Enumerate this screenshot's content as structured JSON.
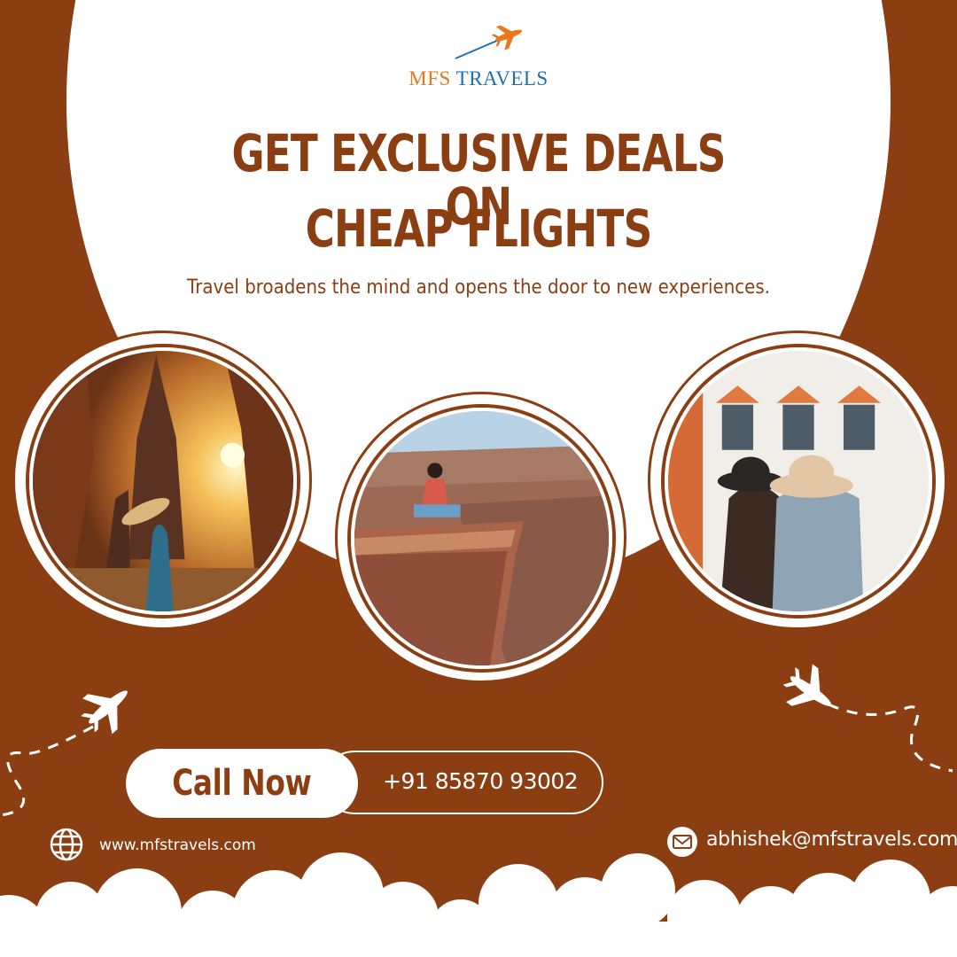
{
  "brand": {
    "part1": "MFS",
    "part2": "TRAVELS",
    "colors": {
      "mfs": "#e8771e",
      "travels": "#1f6fb2"
    }
  },
  "headline": {
    "line1": "GET EXCLUSIVE DEALS ON",
    "line2": "CHEAP FLIGHTS"
  },
  "tagline": "Travel broadens the mind and opens the door to new experiences.",
  "cta": {
    "button_label": "Call Now",
    "phone": "+91 85870 93002"
  },
  "contact": {
    "website": "www.mfstravels.com",
    "email": "abhishek@mfstravels.com",
    "website_icon": "globe-icon",
    "email_icon": "envelope-icon"
  },
  "colors": {
    "primary": "#8a3e12",
    "background": "#ffffff"
  }
}
